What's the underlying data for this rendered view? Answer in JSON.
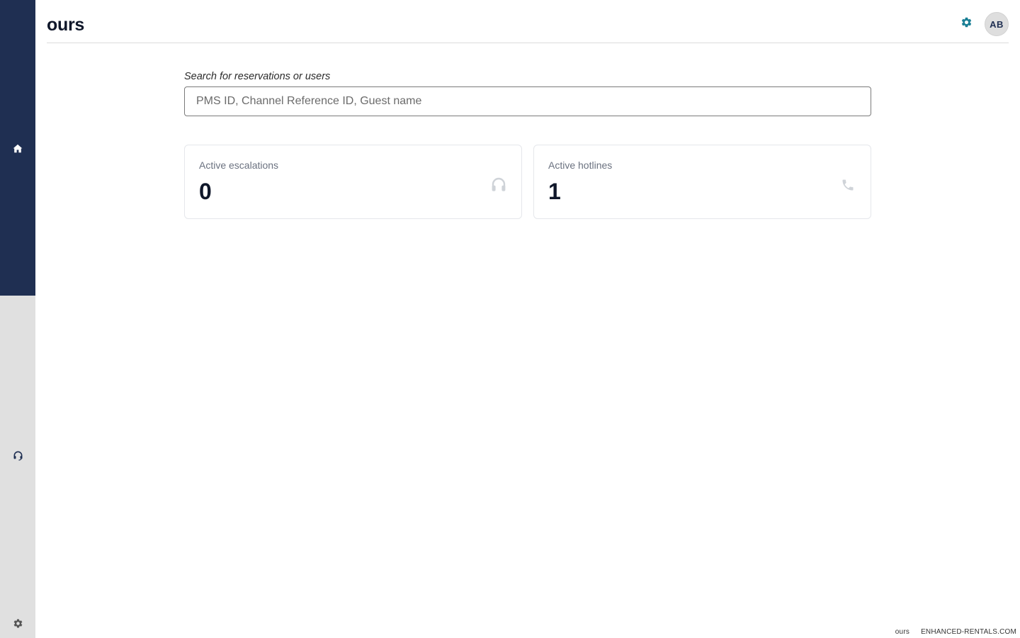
{
  "app": {
    "title": "ours"
  },
  "sidebar": {
    "items": [
      {
        "icon": "home-icon"
      },
      {
        "icon": "headset-icon"
      },
      {
        "icon": "gear-icon"
      }
    ],
    "colors": {
      "top": "#1f2f52",
      "bottom": "#e0e0e0"
    }
  },
  "header": {
    "settings_icon": "gear-icon",
    "avatar_initials": "AB",
    "accent": "#1a7f95"
  },
  "search": {
    "label": "Search for reservations or users",
    "placeholder": "PMS ID, Channel Reference ID, Guest name",
    "value": ""
  },
  "cards": [
    {
      "label": "Active escalations",
      "value": "0",
      "icon": "headset-icon"
    },
    {
      "label": "Active hotlines",
      "value": "1",
      "icon": "phone-icon"
    }
  ],
  "footer": {
    "left": "ours",
    "right": "ENHANCED-RENTALS.COM"
  }
}
